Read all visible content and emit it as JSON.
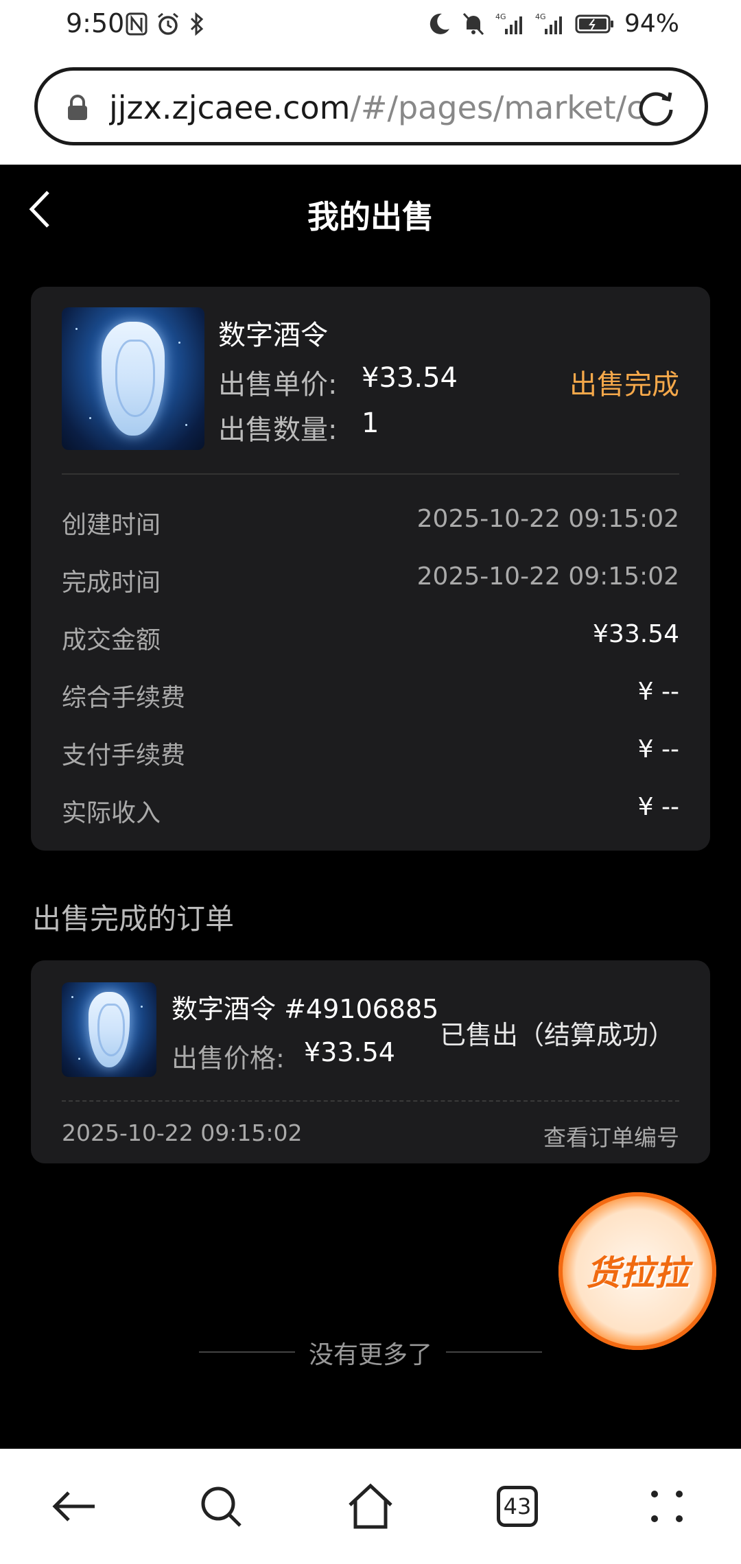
{
  "status_bar": {
    "time": "9:50",
    "battery": "94%"
  },
  "url_bar": {
    "host": "jjzx.zjcaee.com",
    "path": "/#/pages/market/c"
  },
  "header": {
    "title": "我的出售"
  },
  "sale": {
    "name": "数字酒令",
    "price_label": "出售单价:",
    "price_value": "¥33.54",
    "qty_label": "出售数量:",
    "qty_value": "1",
    "status": "出售完成",
    "details": [
      {
        "label": "创建时间",
        "value": "2025-10-22 09:15:02"
      },
      {
        "label": "完成时间",
        "value": "2025-10-22 09:15:02"
      },
      {
        "label": "成交金额",
        "value": "¥33.54"
      },
      {
        "label": "综合手续费",
        "value": "¥ --"
      },
      {
        "label": "支付手续费",
        "value": "¥ --"
      },
      {
        "label": "实际收入",
        "value": "¥ --"
      }
    ]
  },
  "orders_section": {
    "title": "出售完成的订单"
  },
  "order": {
    "name": "数字酒令 #49106885",
    "price_label": "出售价格:",
    "price_value": "¥33.54",
    "status": "已售出（结算成功）",
    "time": "2025-10-22 09:15:02",
    "view_link": "查看订单编号"
  },
  "float_badge": {
    "text": "货拉拉"
  },
  "footer": {
    "no_more": "没有更多了"
  },
  "bottom_nav": {
    "tab_count": "43"
  },
  "colors": {
    "accent_orange": "#f5a84a",
    "card_bg": "#1c1c1e",
    "badge_orange": "#f36a12"
  }
}
